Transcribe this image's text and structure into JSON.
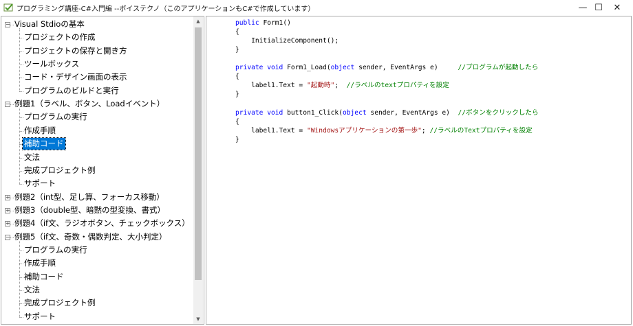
{
  "window": {
    "title": "プログラミング講座-C#入門編 --ポイステクノ（このアプリケーションもC#で作成しています）",
    "controls": {
      "minimize": "—",
      "maximize": "☐",
      "close": "✕"
    }
  },
  "tree": {
    "sections": [
      {
        "label": "Visual Stdioの基本",
        "expanded": true,
        "children": [
          "プロジェクトの作成",
          "プロジェクトの保存と開き方",
          "ツールボックス",
          "コード・デザイン画面の表示",
          "プログラムのビルドと実行"
        ]
      },
      {
        "label": "例題1（ラベル、ボタン、Loadイベント）",
        "expanded": true,
        "children": [
          "プログラムの実行",
          "作成手順",
          "補助コード",
          "文法",
          "完成プロジェクト例",
          "サポート"
        ],
        "selected_child": "補助コード"
      },
      {
        "label": "例題2（int型、足し算、フォーカス移動）",
        "expanded": false
      },
      {
        "label": "例題3（double型、暗黙の型変換、書式）",
        "expanded": false
      },
      {
        "label": "例題4（if文、ラジオボタン、チェックボックス）",
        "expanded": false
      },
      {
        "label": "例題5（if文、奇数・偶数判定、大小判定）",
        "expanded": true,
        "children": [
          "プログラムの実行",
          "作成手順",
          "補助コード",
          "文法",
          "完成プロジェクト例",
          "サポート"
        ]
      }
    ],
    "expander_glyphs": {
      "expanded": "−",
      "collapsed": "+"
    }
  },
  "scrollbar": {
    "up": "▲",
    "down": "▼"
  },
  "code": {
    "lines": [
      [
        {
          "t": "public ",
          "c": "kw"
        },
        {
          "t": "Form1()"
        }
      ],
      [
        {
          "t": "{"
        }
      ],
      [
        {
          "t": "    InitializeComponent();"
        }
      ],
      [
        {
          "t": "}"
        }
      ],
      [],
      [
        {
          "t": "private ",
          "c": "kw"
        },
        {
          "t": "void ",
          "c": "kw"
        },
        {
          "t": "Form1_Load("
        },
        {
          "t": "object ",
          "c": "kw"
        },
        {
          "t": "sender, EventArgs e)     "
        },
        {
          "t": "//プログラムが起動したら",
          "c": "cm"
        }
      ],
      [
        {
          "t": "{"
        }
      ],
      [
        {
          "t": "    label1.Text = "
        },
        {
          "t": "\"起動時\"",
          "c": "st"
        },
        {
          "t": ";  "
        },
        {
          "t": "//ラベルのtextプロパティを設定",
          "c": "cm"
        }
      ],
      [
        {
          "t": "}"
        }
      ],
      [],
      [
        {
          "t": "private ",
          "c": "kw"
        },
        {
          "t": "void ",
          "c": "kw"
        },
        {
          "t": "button1_Click("
        },
        {
          "t": "object ",
          "c": "kw"
        },
        {
          "t": "sender, EventArgs e)  "
        },
        {
          "t": "//ボタンをクリックしたら",
          "c": "cm"
        }
      ],
      [
        {
          "t": "{"
        }
      ],
      [
        {
          "t": "    label1.Text = "
        },
        {
          "t": "\"Windowsアプリケーションの第一歩\"",
          "c": "st"
        },
        {
          "t": "; "
        },
        {
          "t": "//ラベルのTextプロパティを設定",
          "c": "cm"
        }
      ],
      [
        {
          "t": "}"
        }
      ]
    ]
  },
  "colors": {
    "keyword": "#0000ff",
    "comment": "#008000",
    "string": "#a31515",
    "selection": "#0078d7"
  }
}
